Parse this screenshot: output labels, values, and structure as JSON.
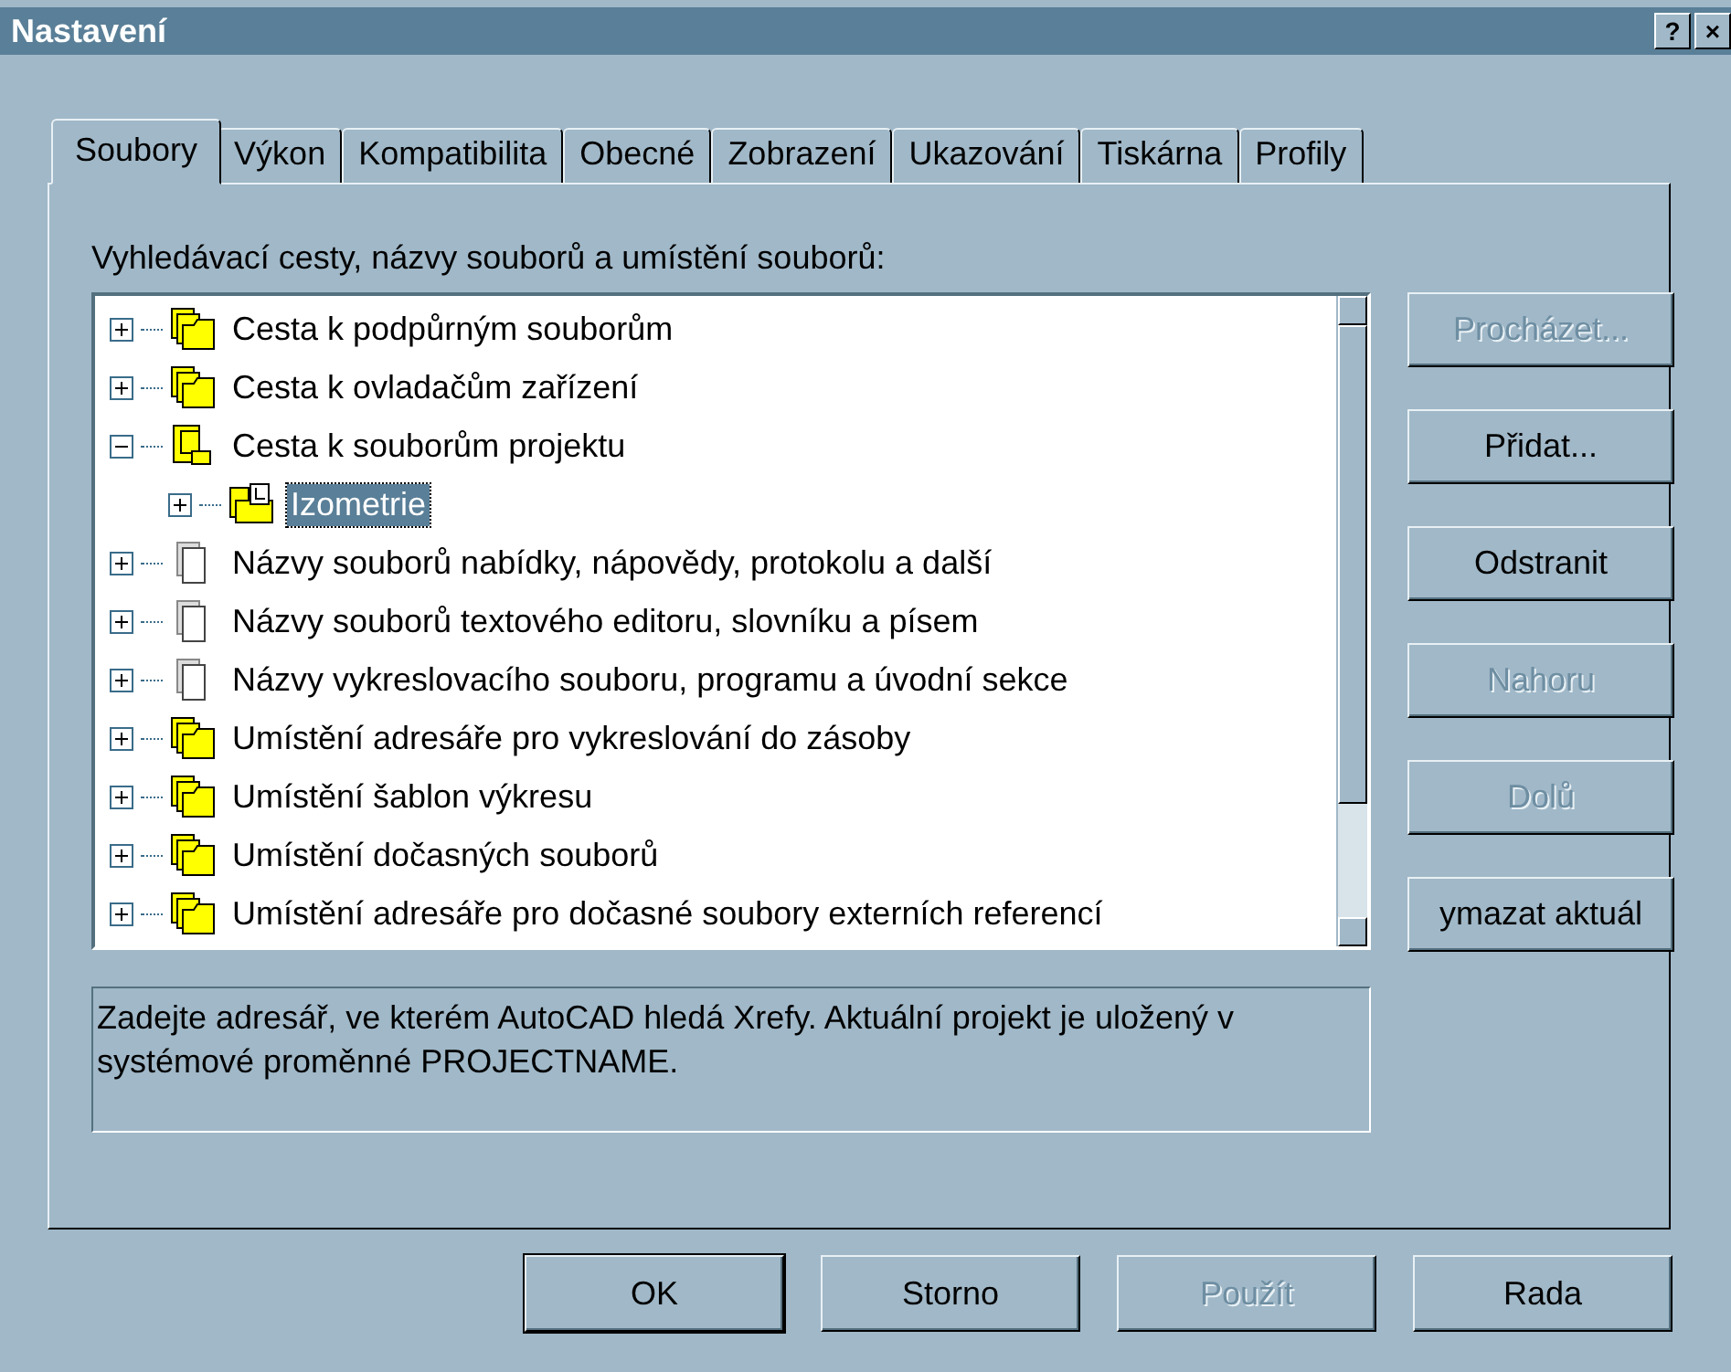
{
  "window": {
    "title": "Nastavení",
    "controls": [
      "?",
      "×"
    ]
  },
  "tabs": [
    {
      "label": "Soubory",
      "selected": true
    },
    {
      "label": "Výkon",
      "selected": false
    },
    {
      "label": "Kompatibilita",
      "selected": false
    },
    {
      "label": "Obecné",
      "selected": false
    },
    {
      "label": "Zobrazení",
      "selected": false
    },
    {
      "label": "Ukazování",
      "selected": false
    },
    {
      "label": "Tiskárna",
      "selected": false
    },
    {
      "label": "Profily",
      "selected": false
    }
  ],
  "tree_label": "Vyhledávací cesty, názvy souborů a umístění souborů:",
  "tree": [
    {
      "label": "Cesta k podpůrným souborům",
      "kind": "folders",
      "expanded": false,
      "selected": false
    },
    {
      "label": "Cesta k ovladačům zařízení",
      "kind": "folders",
      "expanded": false,
      "selected": false
    },
    {
      "label": "Cesta k souborům projektu",
      "kind": "project",
      "expanded": true,
      "selected": false,
      "children": [
        {
          "label": "Izometrie",
          "kind": "drawing",
          "expanded": false,
          "selected": true
        }
      ]
    },
    {
      "label": "Názvy souborů nabídky, nápovědy, protokolu a další",
      "kind": "pages",
      "expanded": false,
      "selected": false
    },
    {
      "label": "Názvy souborů textového editoru, slovníku a písem",
      "kind": "pages",
      "expanded": false,
      "selected": false
    },
    {
      "label": "Názvy vykreslovacího souboru, programu a úvodní sekce",
      "kind": "pages",
      "expanded": false,
      "selected": false
    },
    {
      "label": "Umístění adresáře pro vykreslování do zásoby",
      "kind": "folders",
      "expanded": false,
      "selected": false
    },
    {
      "label": "Umístění šablon výkresu",
      "kind": "folders",
      "expanded": false,
      "selected": false
    },
    {
      "label": "Umístění dočasných souborů",
      "kind": "folders",
      "expanded": false,
      "selected": false
    },
    {
      "label": "Umístění adresáře pro dočasné soubory externích referencí",
      "kind": "folders",
      "expanded": false,
      "selected": false
    }
  ],
  "side_buttons": [
    {
      "label": "Procházet...",
      "disabled": true
    },
    {
      "label": "Přidat...",
      "disabled": false
    },
    {
      "label": "Odstranit",
      "disabled": false
    },
    {
      "label": "Nahoru",
      "disabled": true
    },
    {
      "label": "Dolů",
      "disabled": true
    },
    {
      "label": "ymazat aktuál",
      "disabled": false
    }
  ],
  "description": "Zadejte adresář, ve kterém AutoCAD hledá Xrefy. Aktuální projekt je uložený v systémové proměnné PROJECTNAME.",
  "buttons": [
    {
      "label": "OK",
      "disabled": false,
      "default": true
    },
    {
      "label": "Storno",
      "disabled": false,
      "default": false
    },
    {
      "label": "Použít",
      "disabled": true,
      "default": false
    },
    {
      "label": "Rada",
      "disabled": false,
      "default": false
    }
  ]
}
